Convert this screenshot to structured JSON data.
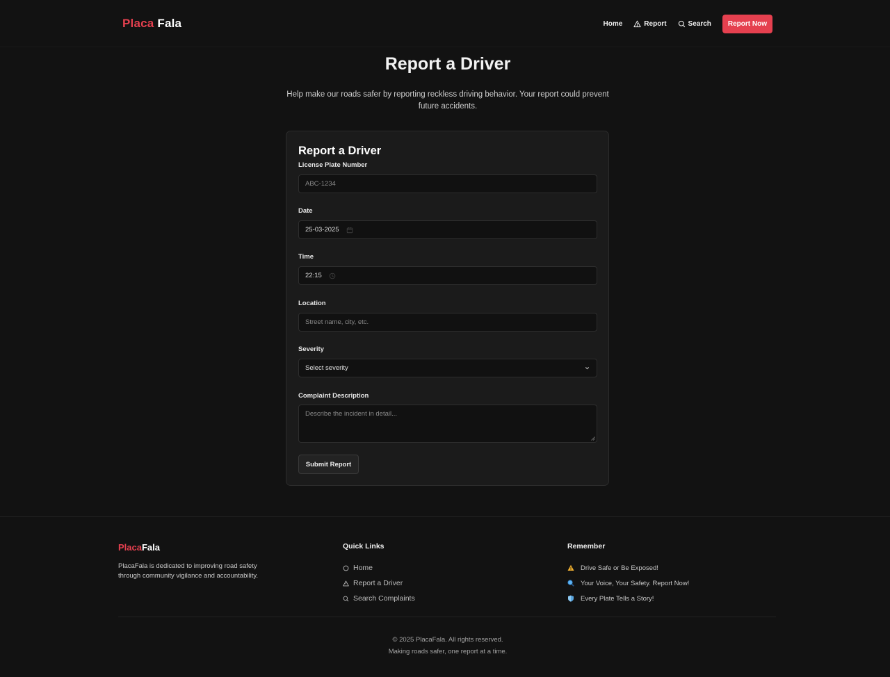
{
  "brand": {
    "part1": "Placa",
    "part2": "Fala"
  },
  "nav": {
    "home": "Home",
    "report": "Report",
    "search": "Search",
    "cta": "Report Now"
  },
  "hero": {
    "title": "Report a Driver",
    "subtitle": "Help make our roads safer by reporting reckless driving behavior. Your report could prevent future accidents."
  },
  "form": {
    "title": "Report a Driver",
    "plate": {
      "label": "License Plate Number",
      "placeholder": "ABC-1234"
    },
    "date": {
      "label": "Date",
      "value": "25-03-2025"
    },
    "time": {
      "label": "Time",
      "value": "22:15"
    },
    "location": {
      "label": "Location",
      "placeholder": "Street name, city, etc."
    },
    "severity": {
      "label": "Severity",
      "value": "Select severity"
    },
    "description": {
      "label": "Complaint Description",
      "placeholder": "Describe the incident in detail..."
    },
    "submit": "Submit Report"
  },
  "footer": {
    "brand": {
      "part1": "Placa",
      "part2": "Fala"
    },
    "description": "PlacaFala is dedicated to improving road safety through community vigilance and accountability.",
    "quick_links": {
      "heading": "Quick Links",
      "items": [
        "Home",
        "Report a Driver",
        "Search Complaints"
      ]
    },
    "remember": {
      "heading": "Remember",
      "items": [
        "Drive Safe or Be Exposed!",
        "Your Voice, Your Safety. Report Now!",
        "Every Plate Tells a Story!"
      ]
    },
    "copyright": "© 2025 PlacaFala. All rights reserved.",
    "tagline": "Making roads safer, one report at a time."
  },
  "colors": {
    "accent": "#e5404f",
    "background": "#121212",
    "card": "#1b1b1b"
  }
}
